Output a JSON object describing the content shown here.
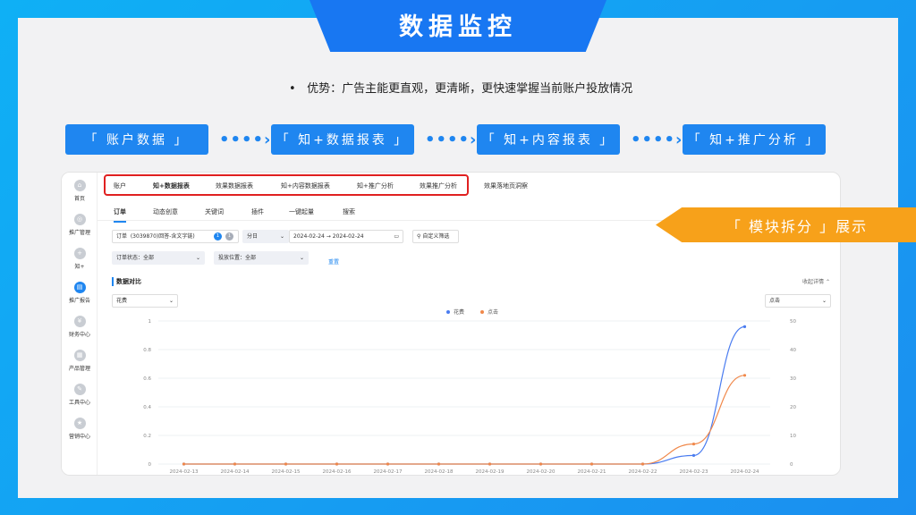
{
  "title": "数据监控",
  "bullet": {
    "dot": "•",
    "text": "优势：广告主能更直观，更清晰，更快速掌握当前账户投放情况"
  },
  "flow": [
    "「 账户数据 」",
    "「 知+数据报表 」",
    "「 知+内容报表 」",
    "「 知+推广分析 」"
  ],
  "flow_arrow": "••••›",
  "callout": "「 模块拆分 」展示",
  "sidebar": [
    "首页",
    "推广管理",
    "知+",
    "推广报告",
    "财务中心",
    "产品管理",
    "工具中心",
    "营销中心"
  ],
  "topnav": [
    "账户",
    "知+数据报表",
    "效果数据报表",
    "知+内容数据报表",
    "知+推广分析",
    "效果推广分析",
    "效果落地页洞察"
  ],
  "subtabs": [
    "订单",
    "动态创意",
    "关键词",
    "插件",
    "一键起量",
    "搜索"
  ],
  "filters": {
    "order_label": "订单",
    "order_value": "(3039870)回答-含文字链)",
    "badge1": "1",
    "badge2": "1",
    "granularity": "分日",
    "date_start": "2024-02-24",
    "date_sep": "→",
    "date_end": "2024-02-24",
    "custom": "自定义筛选",
    "order_status": "订单状态：全部",
    "position": "投放位置：全部",
    "reset": "重置"
  },
  "section_title": "数据对比",
  "collapse": "收起详情",
  "left_metric": "花费",
  "right_metric": "点击",
  "colors": {
    "blue": "#4a7cf0",
    "orange": "#f0884a",
    "brand": "#1f86f0",
    "red": "#e02020"
  },
  "chart_data": {
    "type": "line",
    "x": [
      "2024-02-13",
      "2024-02-14",
      "2024-02-15",
      "2024-02-16",
      "2024-02-17",
      "2024-02-18",
      "2024-02-19",
      "2024-02-20",
      "2024-02-21",
      "2024-02-22",
      "2024-02-23",
      "2024-02-24"
    ],
    "series": [
      {
        "name": "花费",
        "axis": "left",
        "values": [
          0,
          0,
          0,
          0,
          0,
          0,
          0,
          0,
          0,
          0,
          0.06,
          0.96
        ]
      },
      {
        "name": "点击",
        "axis": "right",
        "values": [
          0,
          0,
          0,
          0,
          0,
          0,
          0,
          0,
          0,
          0,
          7,
          31
        ]
      }
    ],
    "ylim_left": [
      0,
      1
    ],
    "yticks_left": [
      "0",
      "0.2",
      "0.4",
      "0.6",
      "0.8",
      "1"
    ],
    "ylim_right": [
      0,
      50
    ],
    "yticks_right": [
      "0",
      "10",
      "20",
      "30",
      "40",
      "50"
    ],
    "legend": "top-center",
    "grid": true
  }
}
